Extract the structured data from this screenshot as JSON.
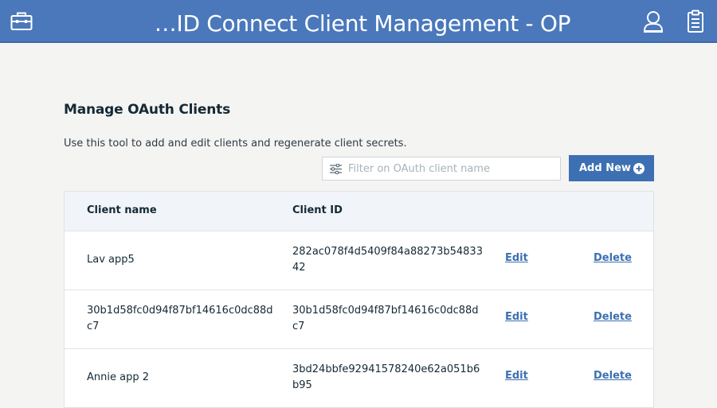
{
  "header": {
    "title": "…ID Connect Client Management - OP",
    "colors": {
      "bar": "#4a78bb",
      "text": "#ffffff"
    },
    "icons": [
      "toolbox-icon",
      "user-icon",
      "clipboard-icon"
    ]
  },
  "main": {
    "heading": "Manage OAuth Clients",
    "description": "Use this tool to add and edit clients and regenerate client secrets.",
    "filter": {
      "placeholder": "Filter on OAuth client name",
      "value": ""
    },
    "add_button": {
      "label": "Add New"
    }
  },
  "table": {
    "columns": {
      "name": "Client name",
      "id": "Client ID"
    },
    "rows": [
      {
        "name": "Lav app5",
        "id": "282ac078f4d5409f84a88273b5483342",
        "edit": "Edit",
        "delete": "Delete"
      },
      {
        "name": "30b1d58fc0d94f87bf14616c0dc88dc7",
        "id": "30b1d58fc0d94f87bf14616c0dc88dc7",
        "edit": "Edit",
        "delete": "Delete"
      },
      {
        "name": "Annie app 2",
        "id": "3bd24bbfe92941578240e62a051b6b95",
        "edit": "Edit",
        "delete": "Delete"
      }
    ]
  },
  "colors": {
    "accent": "#3d70b2",
    "background": "#f4f4f2",
    "header_row": "#f1f5f9"
  }
}
